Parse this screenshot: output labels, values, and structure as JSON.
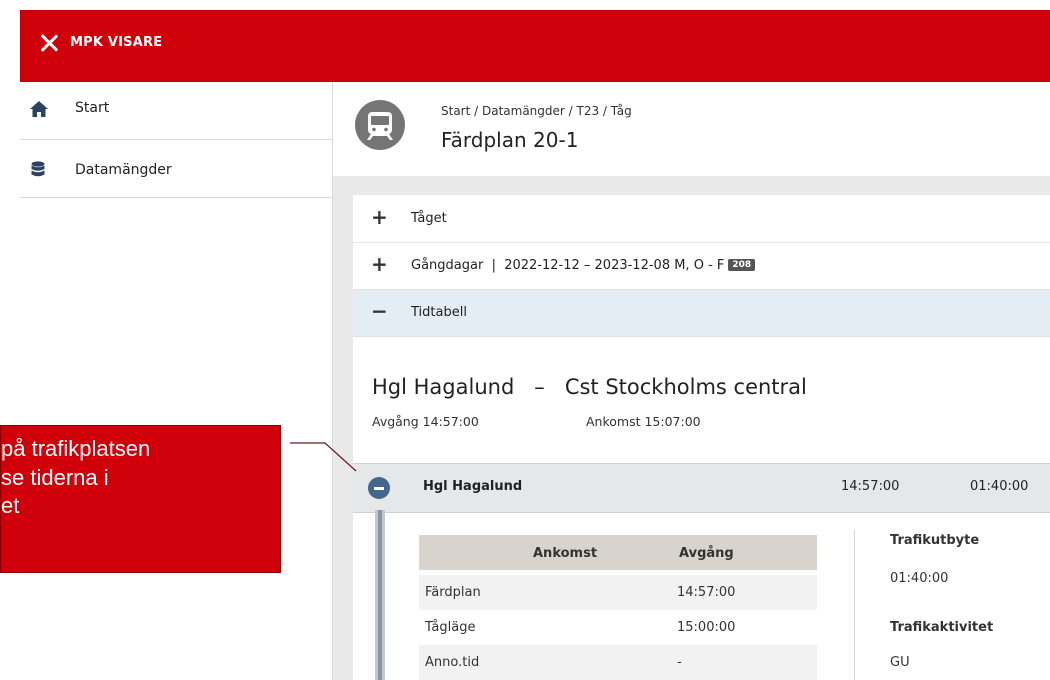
{
  "header": {
    "app_title": "MPK VISARE",
    "accent": "#d0000b"
  },
  "sidebar": {
    "items": [
      {
        "label": "Start",
        "icon": "home-icon"
      },
      {
        "label": "Datamängder",
        "icon": "database-icon"
      }
    ]
  },
  "page": {
    "breadcrumb": "Start / Datamängder / T23 / Tåg",
    "title": "Färdplan 20-1",
    "icon": "train-icon"
  },
  "sections": [
    {
      "sign": "+",
      "label": "Tåget"
    },
    {
      "sign": "+",
      "label": "Gångdagar  |  2022-12-12 – 2023-12-08 M, O - F",
      "badge": "208"
    },
    {
      "sign": "−",
      "label": "Tidtabell"
    }
  ],
  "route": {
    "title": "Hgl Hagalund   –   Cst Stockholms central",
    "departure": "Avgång 14:57:00",
    "arrival": "Ankomst 15:07:00"
  },
  "station": {
    "name": "Hgl Hagalund",
    "time": "14:57:00",
    "duration": "01:40:00"
  },
  "timetable": {
    "columns": [
      "Ankomst",
      "Avgång"
    ],
    "rows": [
      {
        "label": "Färdplan",
        "departure": "14:57:00"
      },
      {
        "label": "Tågläge",
        "departure": "15:00:00"
      },
      {
        "label": "Anno.tid",
        "departure": "-"
      }
    ]
  },
  "station_details": {
    "trafikutbyte_label": "Trafikutbyte",
    "trafikutbyte_value": "01:40:00",
    "trafikaktivitet_label": "Trafikaktivitet",
    "trafikaktivitet_value": "GU"
  },
  "callout": {
    "lines": [
      "på trafikplatsen",
      "se tiderna i",
      "et"
    ]
  }
}
